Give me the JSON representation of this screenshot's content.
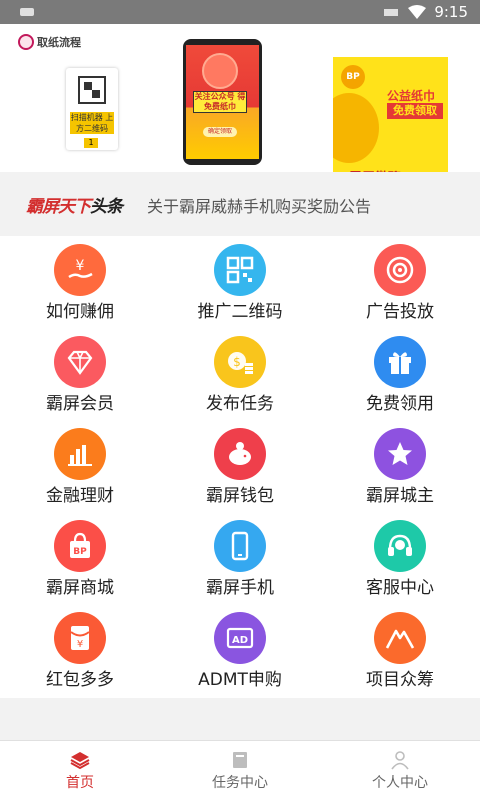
{
  "status_bar": {
    "time": "9:15"
  },
  "banner": {
    "tag_text": "取纸流程",
    "qr_card": {
      "label": "扫描机器 上方二维码",
      "step": "1"
    },
    "phone_card": {
      "sign": "关注公众号 得免费纸巾",
      "button": "确定领取"
    },
    "poster_card": {
      "badge": "BP",
      "title_top": "公益纸巾",
      "title_main": "免费领取",
      "brand": "霸屏微聊"
    },
    "active_slide": 1
  },
  "headline": {
    "brand_red": "霸屏天下",
    "brand_dark": "头条",
    "news": "关于霸屏威赫手机购买奖励公告"
  },
  "grid": {
    "items": [
      {
        "label": "如何赚佣",
        "icon": "money-hand-icon",
        "color": "#ff6a3d"
      },
      {
        "label": "推广二维码",
        "icon": "qr-code-icon",
        "color": "#35b6ee"
      },
      {
        "label": "广告投放",
        "icon": "target-icon",
        "color": "#fb5a55"
      },
      {
        "label": "霸屏会员",
        "icon": "diamond-icon",
        "color": "#fb5a60"
      },
      {
        "label": "发布任务",
        "icon": "coins-icon",
        "color": "#f9c51c"
      },
      {
        "label": "免费领用",
        "icon": "gift-icon",
        "color": "#2f8cf0"
      },
      {
        "label": "金融理财",
        "icon": "bar-chart-icon",
        "color": "#fb7c1c"
      },
      {
        "label": "霸屏钱包",
        "icon": "piggy-bank-icon",
        "color": "#ef3f4b"
      },
      {
        "label": "霸屏城主",
        "icon": "star-icon",
        "color": "#8e52e0"
      },
      {
        "label": "霸屏商城",
        "icon": "shopping-bag-icon",
        "color": "#fb4f48"
      },
      {
        "label": "霸屏手机",
        "icon": "smartphone-icon",
        "color": "#35a8f0"
      },
      {
        "label": "客服中心",
        "icon": "headset-icon",
        "color": "#1ec9a8"
      },
      {
        "label": "红包多多",
        "icon": "red-envelope-icon",
        "color": "#fb5a35"
      },
      {
        "label": "ADMT申购",
        "icon": "ad-icon",
        "color": "#8a55e0"
      },
      {
        "label": "项目众筹",
        "icon": "mountain-icon",
        "color": "#fb6a2c"
      }
    ],
    "ad_text": "AD",
    "shop_text": "BP"
  },
  "tabbar": {
    "tabs": [
      {
        "label": "首页",
        "icon": "home-layers-icon",
        "active": true
      },
      {
        "label": "任务中心",
        "icon": "book-icon",
        "active": false
      },
      {
        "label": "个人中心",
        "icon": "person-icon",
        "active": false
      }
    ]
  },
  "colors": {
    "accent": "#d32f2f",
    "inactive": "#aaaaaa"
  }
}
